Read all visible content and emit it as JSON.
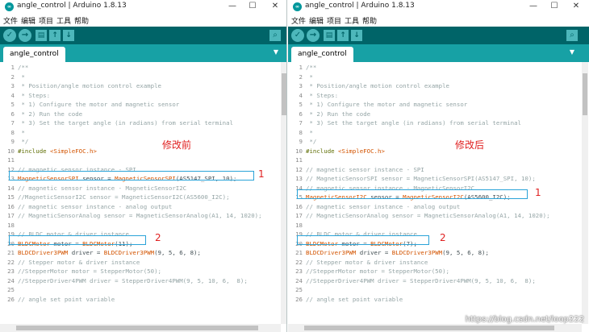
{
  "left_window": {
    "title": "angle_control | Arduino 1.8.13",
    "menu": [
      "文件",
      "编辑",
      "项目",
      "工具",
      "帮助"
    ],
    "tab": "angle_control",
    "annotation_label": "修改前",
    "highlight_1": "1",
    "highlight_2": "2",
    "code": [
      {
        "n": "1",
        "t": "/**"
      },
      {
        "n": "2",
        "t": " *"
      },
      {
        "n": "3",
        "t": " * Position/angle motion control example"
      },
      {
        "n": "4",
        "t": " * Steps:"
      },
      {
        "n": "5",
        "t": " * 1) Configure the motor and magnetic sensor"
      },
      {
        "n": "6",
        "t": " * 2) Run the code"
      },
      {
        "n": "7",
        "t": " * 3) Set the target angle (in radians) from serial terminal"
      },
      {
        "n": "8",
        "t": " *"
      },
      {
        "n": "9",
        "t": " */"
      },
      {
        "n": "10",
        "a": "#include ",
        "b": "<SimpleFOC.h>"
      },
      {
        "n": "11",
        "t": ""
      },
      {
        "n": "12",
        "t": "// magnetic sensor instance - SPI"
      },
      {
        "n": "13",
        "a": "MagneticSensorSPI",
        "b": " sensor = ",
        "c": "MagneticSensorSPI",
        "d": "(AS5147_SPI, 10);"
      },
      {
        "n": "14",
        "t": "// magnetic sensor instance - MagneticSensorI2C"
      },
      {
        "n": "15",
        "t": "//MagneticSensorI2C sensor = MagneticSensorI2C(AS5600_I2C);"
      },
      {
        "n": "16",
        "t": "// magnetic sensor instance - analog output"
      },
      {
        "n": "17",
        "t": "// MagneticSensorAnalog sensor = MagneticSensorAnalog(A1, 14, 1020);"
      },
      {
        "n": "18",
        "t": ""
      },
      {
        "n": "19",
        "t": "// BLDC motor & driver instance"
      },
      {
        "n": "20",
        "a": "BLDCMotor",
        "b": " motor = ",
        "c": "BLDCMotor",
        "d": "(11);"
      },
      {
        "n": "21",
        "a": "BLDCDriver3PWM",
        "b": " driver = ",
        "c": "BLDCDriver3PWM",
        "d": "(9, 5, 6, 8);"
      },
      {
        "n": "22",
        "t": "// Stepper motor & driver instance"
      },
      {
        "n": "23",
        "t": "//StepperMotor motor = StepperMotor(50);"
      },
      {
        "n": "24",
        "t": "//StepperDriver4PWM driver = StepperDriver4PWM(9, 5, 10, 6,  8);"
      },
      {
        "n": "25",
        "t": ""
      },
      {
        "n": "26",
        "t": "// angle set point variable"
      }
    ]
  },
  "right_window": {
    "title": "angle_control | Arduino 1.8.13",
    "menu": [
      "文件",
      "编辑",
      "项目",
      "工具",
      "帮助"
    ],
    "tab": "angle_control",
    "annotation_label": "修改后",
    "highlight_1": "1",
    "highlight_2": "2",
    "code": [
      {
        "n": "1",
        "t": "/**"
      },
      {
        "n": "2",
        "t": " *"
      },
      {
        "n": "3",
        "t": " * Position/angle motion control example"
      },
      {
        "n": "4",
        "t": " * Steps:"
      },
      {
        "n": "5",
        "t": " * 1) Configure the motor and magnetic sensor"
      },
      {
        "n": "6",
        "t": " * 2) Run the code"
      },
      {
        "n": "7",
        "t": " * 3) Set the target angle (in radians) from serial terminal"
      },
      {
        "n": "8",
        "t": " *"
      },
      {
        "n": "9",
        "t": " */"
      },
      {
        "n": "10",
        "a": "#include ",
        "b": "<SimpleFOC.h>"
      },
      {
        "n": "11",
        "t": ""
      },
      {
        "n": "12",
        "t": "// magnetic sensor instance - SPI"
      },
      {
        "n": "13",
        "t": "// MagneticSensorSPI sensor = MagneticSensorSPI(AS5147_SPI, 10);"
      },
      {
        "n": "14",
        "t": "// magnetic sensor instance - MagneticSensorI2C"
      },
      {
        "n": "15",
        "a": "MagneticSensorI2C",
        "b": " sensor = ",
        "c": "MagneticSensorI2C",
        "d": "(AS5600_I2C);"
      },
      {
        "n": "16",
        "t": "// magnetic sensor instance - analog output"
      },
      {
        "n": "17",
        "t": "// MagneticSensorAnalog sensor = MagneticSensorAnalog(A1, 14, 1020);"
      },
      {
        "n": "18",
        "t": ""
      },
      {
        "n": "19",
        "t": "// BLDC motor & driver instance"
      },
      {
        "n": "20",
        "a": "BLDCMotor",
        "b": " motor = ",
        "c": "BLDCMotor",
        "d": "(7);"
      },
      {
        "n": "21",
        "a": "BLDCDriver3PWM",
        "b": " driver = ",
        "c": "BLDCDriver3PWM",
        "d": "(9, 5, 6, 8);"
      },
      {
        "n": "22",
        "t": "// Stepper motor & driver instance"
      },
      {
        "n": "23",
        "t": "//StepperMotor motor = StepperMotor(50);"
      },
      {
        "n": "24",
        "t": "//StepperDriver4PWM driver = StepperDriver4PWM(9, 5, 10, 6,  8);"
      },
      {
        "n": "25",
        "t": ""
      },
      {
        "n": "26",
        "t": "// angle set point variable"
      }
    ]
  },
  "watermark": "https://blog.csdn.net/loop222",
  "colors": {
    "toolbar": "#006468",
    "tabbar": "#17a1a5",
    "keyword": "#5e6d03",
    "type": "#d35400",
    "comment": "#95a5a6",
    "annotation": "#e02020",
    "highlight_border": "#2aa3d8"
  },
  "icons": [
    "arduino-logo-icon",
    "verify-icon",
    "upload-icon",
    "new-icon",
    "open-icon",
    "save-icon",
    "serial-monitor-icon",
    "tab-menu-icon"
  ]
}
